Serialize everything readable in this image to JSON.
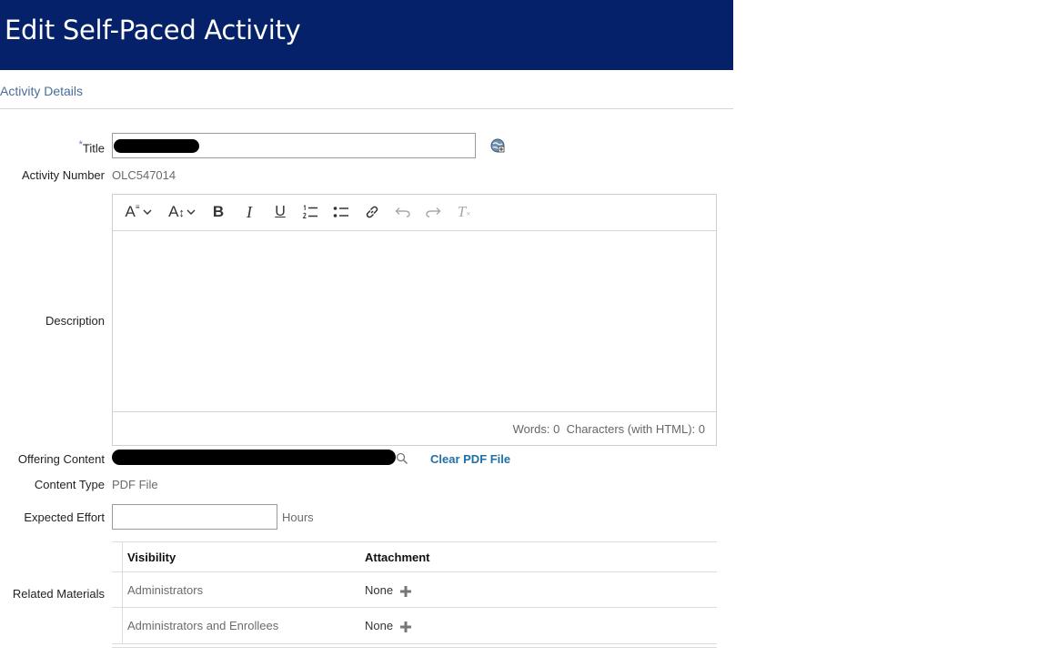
{
  "header": {
    "title": "Edit Self-Paced Activity"
  },
  "section": {
    "tab": "Activity Details"
  },
  "form": {
    "title_required_marker": "*",
    "title_label": "Title",
    "activity_number_label": "Activity Number",
    "activity_number_value": "OLC547014",
    "description_label": "Description",
    "offering_content_label": "Offering Content",
    "clear_pdf_label": "Clear PDF File",
    "content_type_label": "Content Type",
    "content_type_value": "PDF File",
    "expected_effort_label": "Expected Effort",
    "expected_effort_value": "",
    "expected_effort_unit": "Hours",
    "related_materials_label": "Related Materials"
  },
  "editor": {
    "toolbar": [
      {
        "name": "font-style-dropdown",
        "icon": "text-style-icon"
      },
      {
        "name": "font-size-dropdown",
        "icon": "text-size-icon"
      },
      {
        "name": "bold-button",
        "icon": "bold-icon"
      },
      {
        "name": "italic-button",
        "icon": "italic-icon"
      },
      {
        "name": "underline-button",
        "icon": "underline-icon"
      },
      {
        "name": "numbered-list-button",
        "icon": "numbered-list-icon"
      },
      {
        "name": "bullet-list-button",
        "icon": "bullet-list-icon"
      },
      {
        "name": "link-button",
        "icon": "link-icon"
      },
      {
        "name": "undo-button",
        "icon": "undo-icon",
        "disabled": true
      },
      {
        "name": "redo-button",
        "icon": "redo-icon",
        "disabled": true
      },
      {
        "name": "clear-format-button",
        "icon": "clear-format-icon",
        "disabled": true
      }
    ],
    "toolbar_glyphs": {
      "font_style": "A",
      "font_size": "A",
      "bold": "B",
      "italic": "I",
      "underline": "U",
      "clear": "T"
    },
    "counter": "Words: 0  Characters (with HTML): 0"
  },
  "related_materials": {
    "columns": [
      "Visibility",
      "Attachment"
    ],
    "rows": [
      {
        "visibility": "Administrators",
        "attachment": "None"
      },
      {
        "visibility": "Administrators and Enrollees",
        "attachment": "None"
      }
    ]
  },
  "colors": {
    "header_bg": "#05216a",
    "link": "#1f6fa8",
    "section_tab": "#4a6d9c"
  }
}
